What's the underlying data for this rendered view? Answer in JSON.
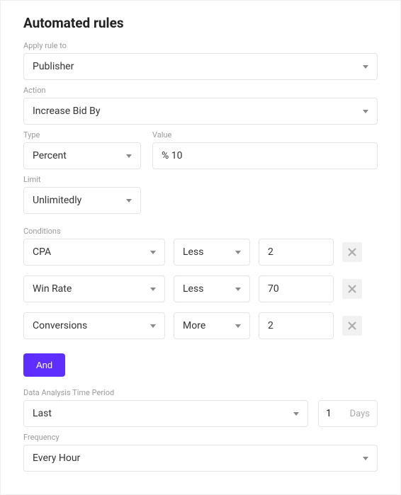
{
  "title": "Automated rules",
  "labels": {
    "apply_rule_to": "Apply rule to",
    "action": "Action",
    "type": "Type",
    "value": "Value",
    "limit": "Limit",
    "conditions": "Conditions",
    "data_period": "Data Analysis Time Period",
    "frequency": "Frequency"
  },
  "apply_to": "Publisher",
  "action": "Increase Bid By",
  "type": "Percent",
  "value": "% 10",
  "limit": "Unlimitedly",
  "conditions": [
    {
      "metric": "CPA",
      "operator": "Less",
      "value": "2"
    },
    {
      "metric": "Win Rate",
      "operator": "Less",
      "value": "70"
    },
    {
      "metric": "Conversions",
      "operator": "More",
      "value": "2"
    }
  ],
  "and_label": "And",
  "period": {
    "mode": "Last",
    "value": "1",
    "unit": "Days"
  },
  "frequency": "Every Hour"
}
